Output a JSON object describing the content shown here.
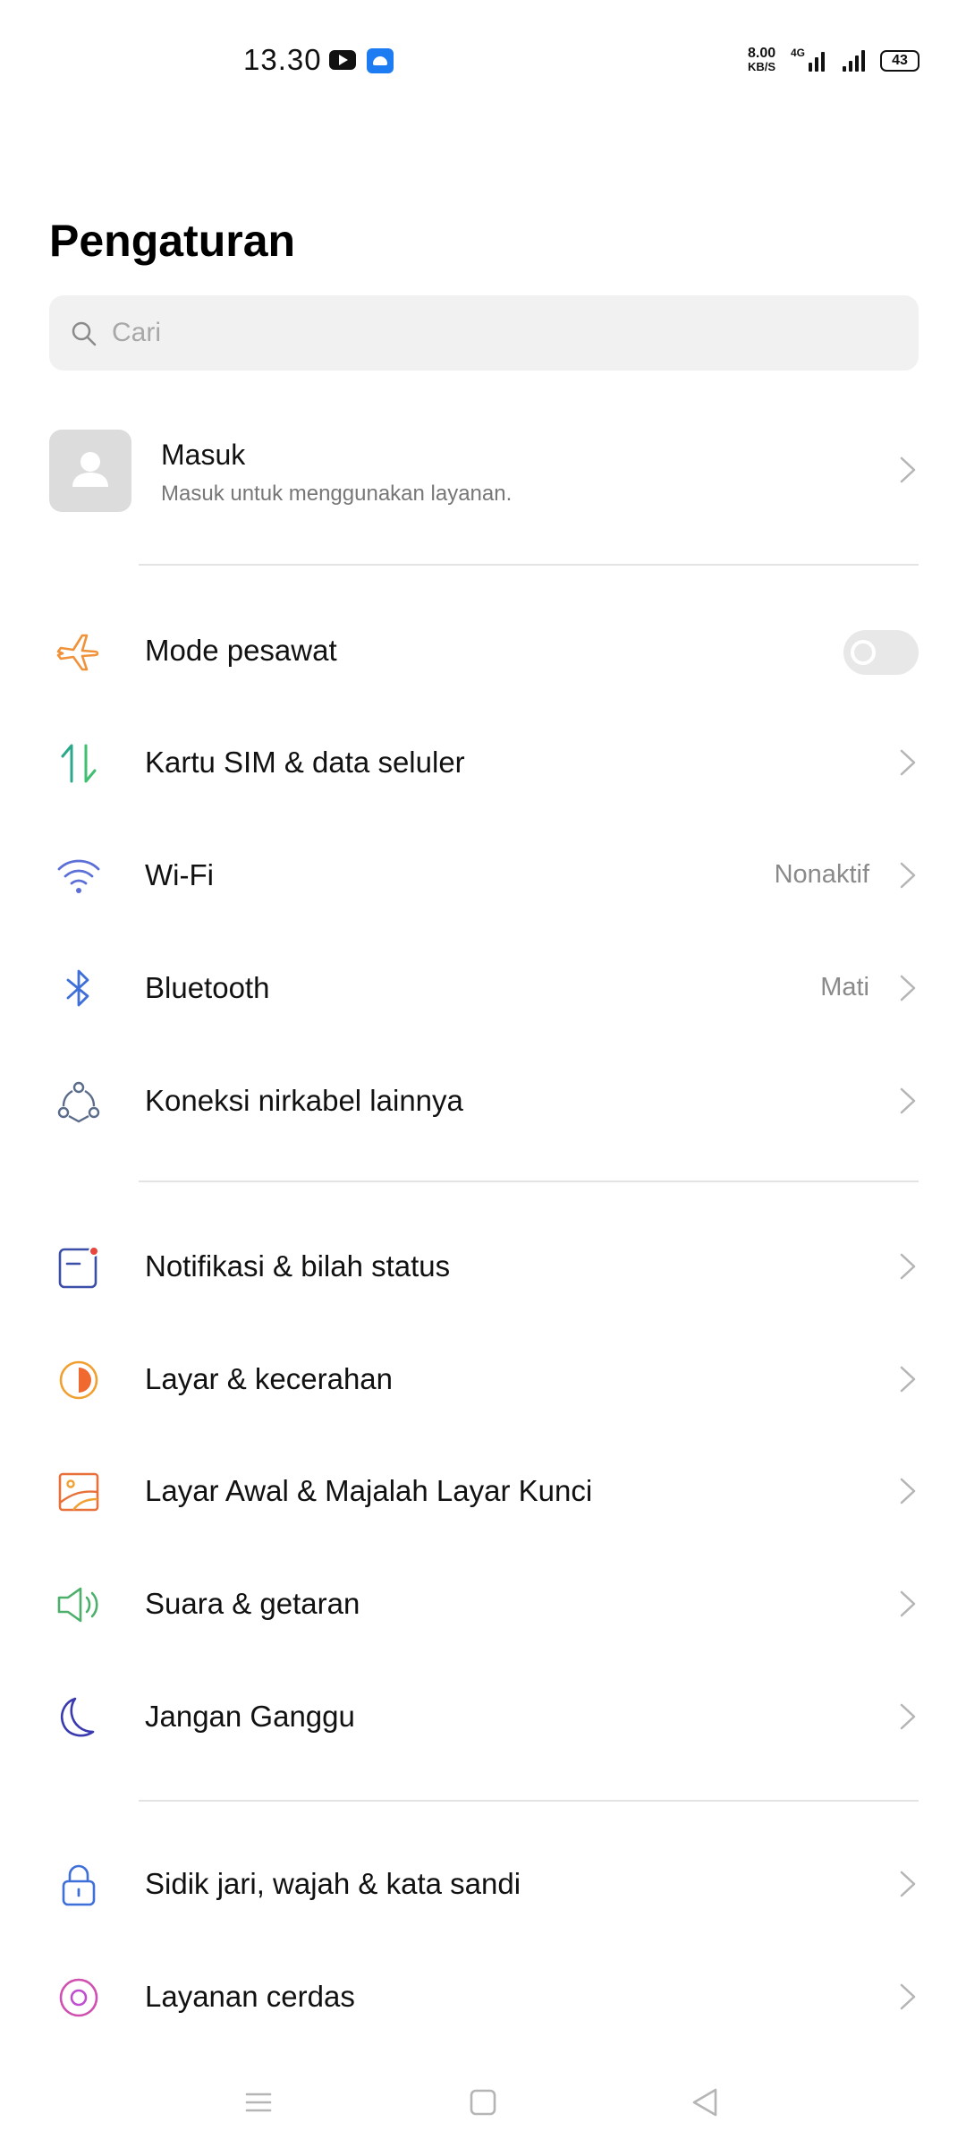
{
  "status_bar": {
    "time": "13.30",
    "net_speed_value": "8.00",
    "net_speed_unit": "KB/S",
    "network_type": "4G",
    "battery": "43",
    "icons": [
      "youtube-icon",
      "app-notification-icon",
      "signal-4g-icon",
      "signal-icon",
      "battery-icon"
    ]
  },
  "header": {
    "title": "Pengaturan"
  },
  "search": {
    "placeholder": "Cari",
    "value": ""
  },
  "account": {
    "title": "Masuk",
    "subtitle": "Masuk untuk menggunakan layanan."
  },
  "sections": [
    [
      {
        "label": "Mode pesawat",
        "icon": "airplane-icon",
        "color": "#f0923a",
        "toggle": false
      },
      {
        "label": "Kartu SIM & data seluler",
        "icon": "sim-data-icon",
        "color": "#2aa88a"
      },
      {
        "label": "Wi-Fi",
        "icon": "wifi-icon",
        "color": "#5b6fd6",
        "value": "Nonaktif"
      },
      {
        "label": "Bluetooth",
        "icon": "bluetooth-icon",
        "color": "#3f6fd8",
        "value": "Mati"
      },
      {
        "label": "Koneksi nirkabel lainnya",
        "icon": "wireless-connection-icon",
        "color": "#5b6b8a"
      }
    ],
    [
      {
        "label": "Notifikasi & bilah status",
        "icon": "notification-icon",
        "color": "#3c4fa8"
      },
      {
        "label": "Layar & kecerahan",
        "icon": "brightness-icon",
        "color": "#f0a030"
      },
      {
        "label": "Layar Awal & Majalah Layar Kunci",
        "icon": "wallpaper-icon",
        "color": "#e8703a"
      },
      {
        "label": "Suara & getaran",
        "icon": "sound-icon",
        "color": "#4caf6a"
      },
      {
        "label": "Jangan Ganggu",
        "icon": "moon-icon",
        "color": "#3a3ab0"
      }
    ],
    [
      {
        "label": "Sidik jari, wajah & kata sandi",
        "icon": "lock-icon",
        "color": "#3f6fd8"
      },
      {
        "label": "Layanan cerdas",
        "icon": "smart-service-icon",
        "color": "#d04fb0"
      }
    ]
  ],
  "nav_bar": {
    "icons": [
      "menu-icon",
      "home-icon",
      "back-icon"
    ]
  }
}
